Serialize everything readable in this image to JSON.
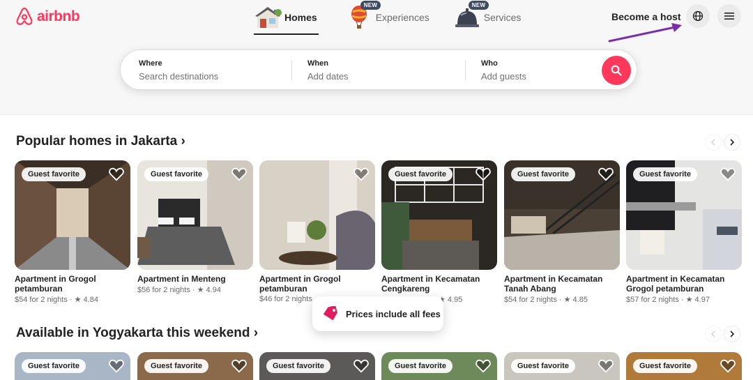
{
  "brand": {
    "name": "airbnb",
    "color": "#ff385c"
  },
  "nav": [
    {
      "label": "Homes",
      "icon": "house-icon",
      "badge": ""
    },
    {
      "label": "Experiences",
      "icon": "balloon-icon",
      "badge": "NEW"
    },
    {
      "label": "Services",
      "icon": "service-bell-icon",
      "badge": "NEW"
    }
  ],
  "header": {
    "host_label": "Become a host",
    "globe_icon": "globe-icon",
    "menu_icon": "menu-icon"
  },
  "search": {
    "where_label": "Where",
    "where_placeholder": "Search destinations",
    "when_label": "When",
    "when_placeholder": "Add dates",
    "who_label": "Who",
    "who_placeholder": "Add guests"
  },
  "sections": [
    {
      "title": "Popular homes in Jakarta ›",
      "listings": [
        {
          "badge": "Guest favorite",
          "title": "Apartment in Grogol petamburan",
          "meta": "$54 for 2 nights · ★ 4.84"
        },
        {
          "badge": "Guest favorite",
          "title": "Apartment in Menteng",
          "meta": "$56 for 2 nights · ★ 4.94"
        },
        {
          "badge": "",
          "title": "Apartment in Grogol petamburan",
          "meta": "$46 for 2 nights"
        },
        {
          "badge": "Guest favorite",
          "title": "Apartment in Kecamatan Cengkareng",
          "meta": "★ 4.95"
        },
        {
          "badge": "Guest favorite",
          "title": "Apartment in Kecamatan Tanah Abang",
          "meta": "$54 for 2 nights · ★ 4.85"
        },
        {
          "badge": "Guest favorite",
          "title": "Apartment in Kecamatan Grogol petamburan",
          "meta": "$57 for 2 nights · ★ 4.97"
        }
      ]
    },
    {
      "title": "Available in Yogyakarta this weekend ›",
      "listings": [
        {
          "badge": "Guest favorite"
        },
        {
          "badge": "Guest favorite"
        },
        {
          "badge": "Guest favorite"
        },
        {
          "badge": "Guest favorite"
        },
        {
          "badge": "Guest favorite"
        },
        {
          "badge": "Guest favorite"
        }
      ]
    }
  ],
  "toast": {
    "text": "Prices include all fees",
    "icon": "price-tag-icon"
  },
  "annotation": {
    "color": "#7b2fa8"
  }
}
